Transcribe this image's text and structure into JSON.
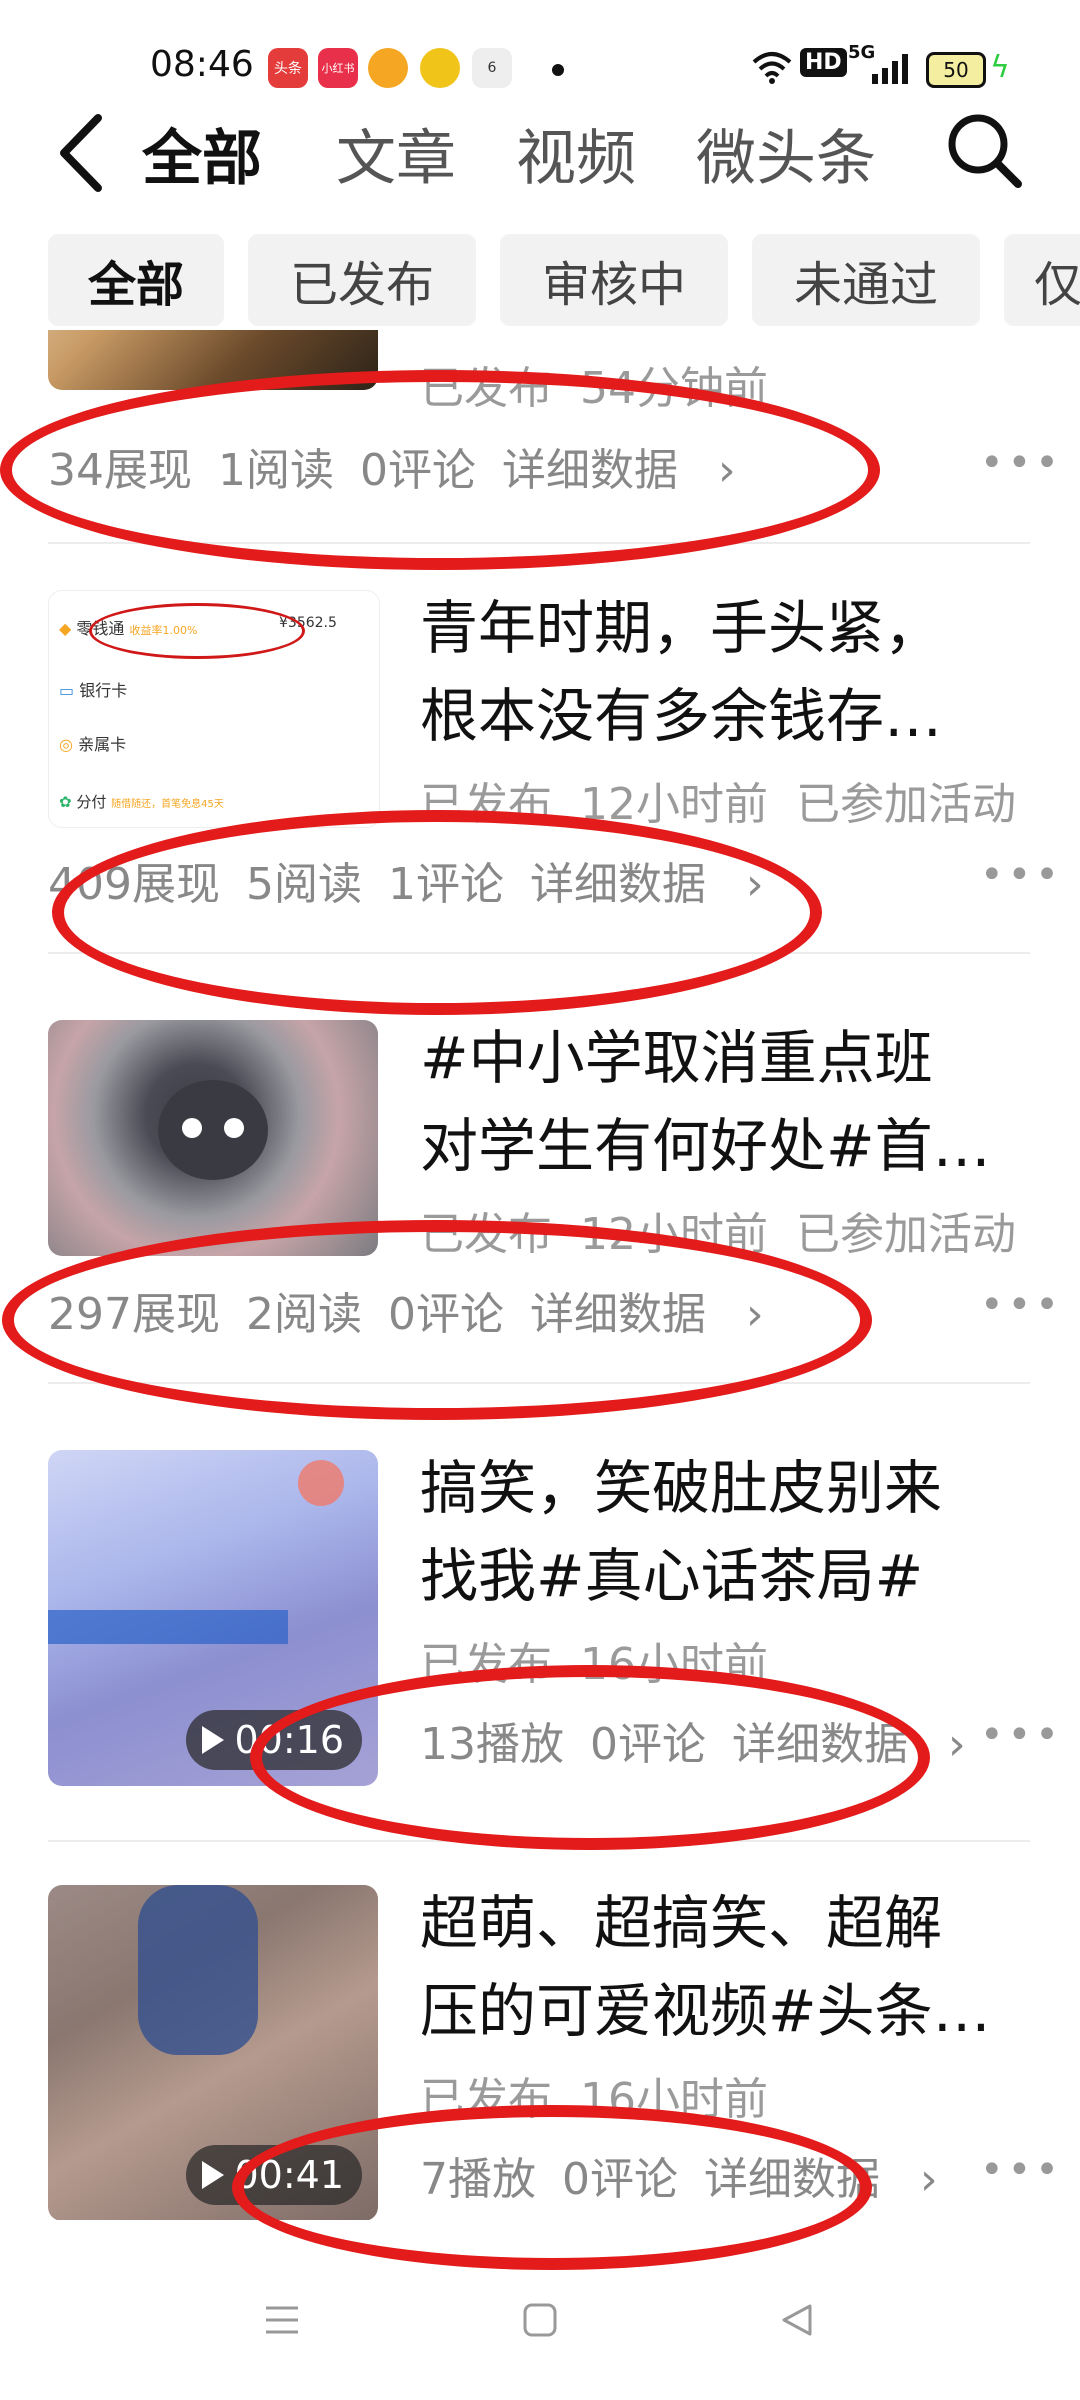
{
  "status_bar": {
    "time": "08:46",
    "app_icons": [
      {
        "name": "toutiao-icon",
        "label": "头条",
        "color": "#e43b3b"
      },
      {
        "name": "xiaohongshu-icon",
        "label": "小红书",
        "color": "#e8304a"
      },
      {
        "name": "video-app-icon",
        "label": "",
        "color": "#f5a623"
      },
      {
        "name": "weibo-icon",
        "label": "",
        "color": "#f0c419"
      },
      {
        "name": "weather-icon",
        "label": "6",
        "color": "#dddddd"
      }
    ],
    "hd_label": "HD",
    "signal_label": "5G",
    "battery": "50"
  },
  "header": {
    "tabs": [
      "全部",
      "文章",
      "视频",
      "微头条"
    ],
    "active_tab": "全部"
  },
  "filters": {
    "chips": [
      "全部",
      "已发布",
      "审核中",
      "未通过",
      "仅"
    ],
    "active": "全部"
  },
  "items": [
    {
      "title_lines": [
        "",
        ""
      ],
      "status": "已发布",
      "time": "54分钟前",
      "activity": "",
      "stats": [
        "34展现",
        "1阅读",
        "0评论"
      ],
      "detail": "详细数据",
      "video_duration": ""
    },
    {
      "title_lines": [
        "青年时期，手头紧，",
        "根本没有多余钱存…"
      ],
      "status": "已发布",
      "time": "12小时前",
      "activity": "已参加活动",
      "stats": [
        "409展现",
        "5阅读",
        "1评论"
      ],
      "detail": "详细数据",
      "video_duration": "",
      "thumb_text": {
        "row1": "零钱通",
        "row1_rate": "收益率1.00%",
        "row1_amount": "¥3562.5",
        "row2": "银行卡",
        "row3": "亲属卡",
        "row4": "分付",
        "row4_note": "随借随还，首笔免息45天"
      }
    },
    {
      "title_lines": [
        "#中小学取消重点班",
        "对学生有何好处#首…"
      ],
      "status": "已发布",
      "time": "12小时前",
      "activity": "已参加活动",
      "stats": [
        "297展现",
        "2阅读",
        "0评论"
      ],
      "detail": "详细数据",
      "video_duration": ""
    },
    {
      "title_lines": [
        "搞笑，笑破肚皮别来",
        "找我#真心话茶局#"
      ],
      "status": "已发布",
      "time": "16小时前",
      "activity": "",
      "stats": [
        "13播放",
        "0评论"
      ],
      "detail": "详细数据",
      "video_duration": "00:16"
    },
    {
      "title_lines": [
        "超萌、超搞笑、超解",
        "压的可爱视频#头条…"
      ],
      "status": "已发布",
      "time": "16小时前",
      "activity": "",
      "stats": [
        "7播放",
        "0评论"
      ],
      "detail": "详细数据",
      "video_duration": "00:41"
    }
  ],
  "colors": {
    "annotation_red": "#e31b1b",
    "meta_gray": "#9a9a9a",
    "chip_bg": "#f2f2f2"
  }
}
